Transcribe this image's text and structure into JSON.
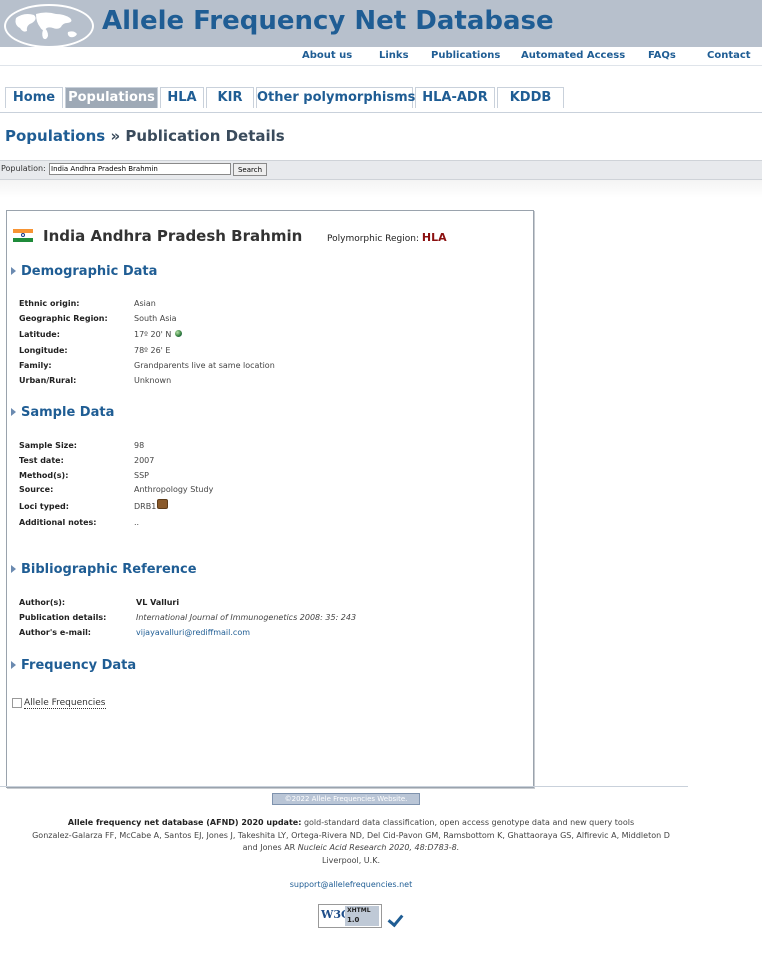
{
  "header": {
    "site_title": "Allele Frequency Net Database",
    "logo_icon": "world-map-icon"
  },
  "toplinks": [
    "About us",
    "Links",
    "Publications",
    "Automated Access",
    "FAQs",
    "Contact"
  ],
  "tabs": [
    {
      "label": "Home",
      "active": false
    },
    {
      "label": "Populations",
      "active": true
    },
    {
      "label": "HLA",
      "active": false
    },
    {
      "label": "KIR",
      "active": false
    },
    {
      "label": "Other polymorphisms",
      "active": false
    },
    {
      "label": "HLA-ADR",
      "active": false
    },
    {
      "label": "KDDB",
      "active": false
    }
  ],
  "breadcrumb": {
    "section": "Populations",
    "separator": "»",
    "page": "Publication Details"
  },
  "search": {
    "label": "Population:",
    "value": "India Andhra Pradesh Brahmin",
    "button": "Search"
  },
  "population": {
    "name": "India Andhra Pradesh Brahmin",
    "polymorphic_label": "Polymorphic Region:",
    "polymorphic_value": "HLA",
    "flag_icon": "india-flag-icon"
  },
  "sections": {
    "demographic": {
      "title": "Demographic Data",
      "rows": [
        {
          "key": "Ethnic origin:",
          "value": "Asian"
        },
        {
          "key": "Geographic Region:",
          "value": "South Asia"
        },
        {
          "key": "Latitude:",
          "value": "17º 20' N"
        },
        {
          "key": "Longitude:",
          "value": "78º 26' E"
        },
        {
          "key": "Family:",
          "value": "Grandparents live at same location"
        },
        {
          "key": "Urban/Rural:",
          "value": "Unknown"
        }
      ]
    },
    "sample": {
      "title": "Sample Data",
      "rows": [
        {
          "key": "Sample Size:",
          "value": "98"
        },
        {
          "key": "Test date:",
          "value": "2007"
        },
        {
          "key": "Method(s):",
          "value": "SSP"
        },
        {
          "key": "Source:",
          "value": "Anthropology Study"
        },
        {
          "key": "Loci typed:",
          "value": "DRB1"
        },
        {
          "key": "Additional notes:",
          "value": ".."
        }
      ]
    },
    "bibliographic": {
      "title": "Bibliographic Reference",
      "rows": [
        {
          "key": "Author(s):",
          "value": "VL Valluri"
        },
        {
          "key": "Publication details:",
          "value": "International Journal of Immunogenetics 2008: 35: 243"
        },
        {
          "key": "Author's e-mail:",
          "value": "vijayavalluri@rediffmail.com"
        }
      ]
    },
    "frequency": {
      "title": "Frequency Data",
      "link": "Allele Frequencies"
    }
  },
  "footer": {
    "copyright": "©2022 Allele Frequencies Website.",
    "cite_bold": "Allele frequency net database (AFND) 2020 update:",
    "cite_rest": "gold-standard data classification, open access genotype data and new query tools",
    "cite_authors": "Gonzalez-Galarza FF, McCabe A, Santos EJ, Jones J, Takeshita LY, Ortega-Rivera ND, Del Cid-Pavon GM, Ramsbottom K, Ghattaoraya GS, Alfirevic A, Middleton D",
    "cite_and": "and Jones AR",
    "cite_journal": "Nucleic Acid Research 2020, 48:D783-8.",
    "location": "Liverpool, U.K.",
    "support": "support@allelefrequencies.net",
    "badge_w3c": "W3C",
    "badge_line1": "XHTML",
    "badge_line2": "1.0"
  }
}
